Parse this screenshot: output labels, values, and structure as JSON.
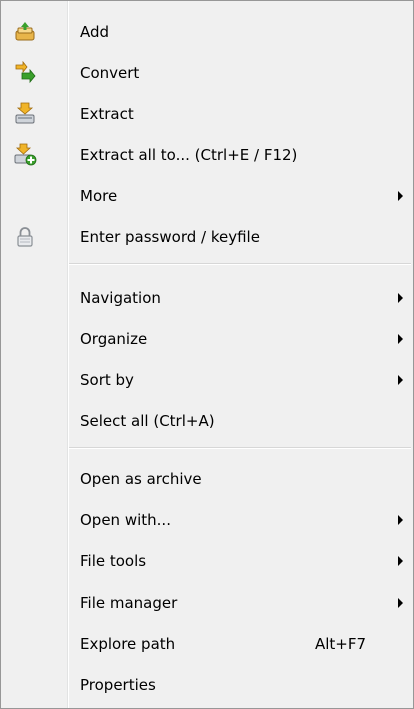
{
  "menu": {
    "items": [
      {
        "label": "Add",
        "icon": "archive-add-icon"
      },
      {
        "label": "Convert",
        "icon": "convert-icon"
      },
      {
        "label": "Extract",
        "icon": "extract-icon"
      },
      {
        "label": "Extract all to... (Ctrl+E / F12)",
        "icon": "extract-all-icon"
      },
      {
        "label": "More",
        "submenu": true
      },
      {
        "label": "Enter password / keyfile",
        "icon": "lock-icon"
      },
      {
        "label": "Navigation",
        "submenu": true
      },
      {
        "label": "Organize",
        "submenu": true
      },
      {
        "label": "Sort by",
        "submenu": true
      },
      {
        "label": "Select all (Ctrl+A)"
      },
      {
        "label": "Open as archive"
      },
      {
        "label": "Open with...",
        "submenu": true
      },
      {
        "label": "File tools",
        "submenu": true
      },
      {
        "label": "File manager",
        "submenu": true
      },
      {
        "label": "Explore path",
        "shortcut": "Alt+F7"
      },
      {
        "label": "Properties"
      }
    ]
  },
  "colors": {
    "background": "#f0f0f0",
    "border": "#979797",
    "icon_green": "#3aa02c",
    "icon_yellow": "#f2c94c"
  }
}
